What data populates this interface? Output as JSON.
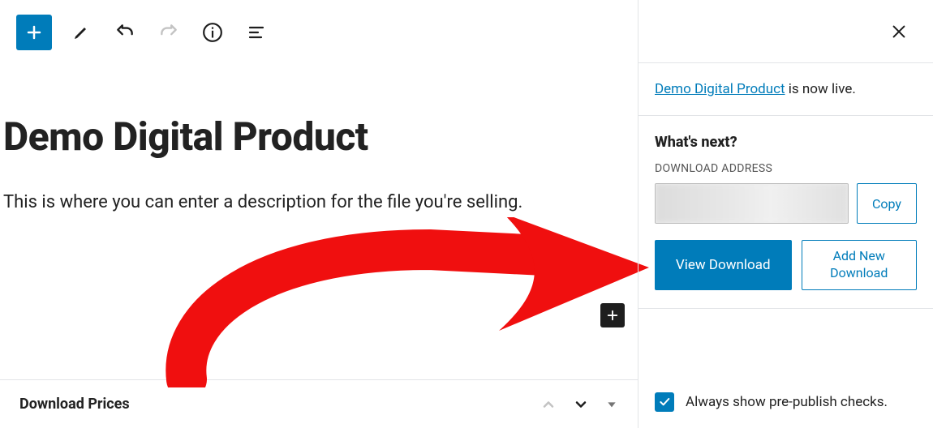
{
  "toolbar": {},
  "editor": {
    "title": "Demo Digital Product",
    "description": "This is where you can enter a description for the file you're selling."
  },
  "panel": {
    "title": "Download Prices"
  },
  "sidebar": {
    "notice": {
      "link_text": "Demo Digital Product",
      "suffix": " is now live."
    },
    "next": {
      "heading": "What's next?",
      "address_label": "DOWNLOAD ADDRESS",
      "copy": "Copy",
      "view": "View Download",
      "add_new_line1": "Add New",
      "add_new_line2": "Download"
    },
    "checkbox": {
      "label": "Always show pre-publish checks."
    }
  }
}
